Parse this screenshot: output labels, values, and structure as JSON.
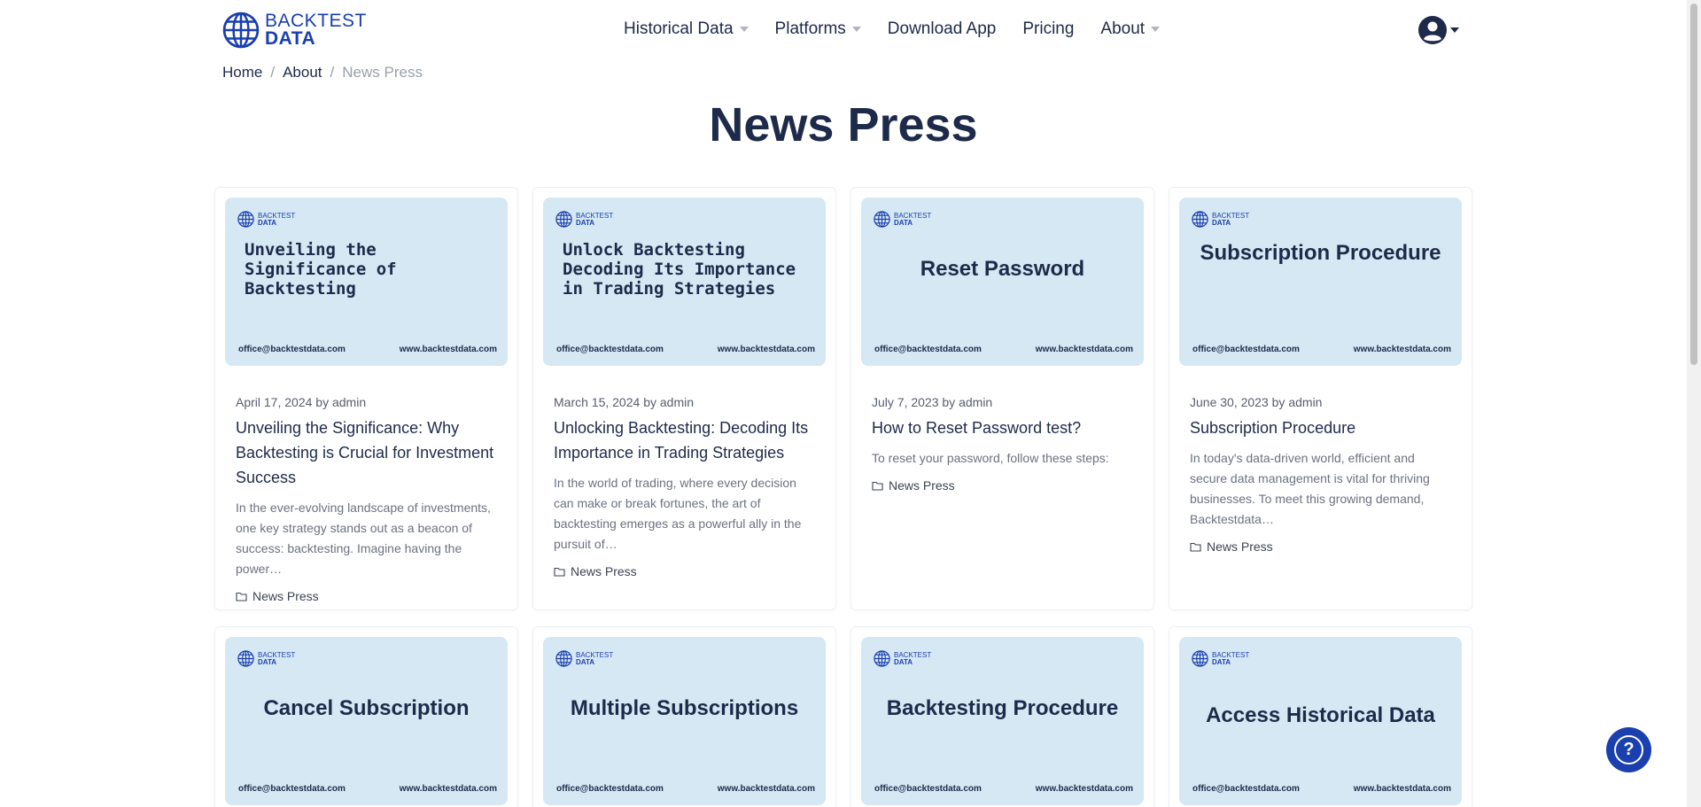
{
  "logo": {
    "line1": "BACKTEST",
    "line2": "DATA"
  },
  "nav": [
    {
      "label": "Historical Data",
      "has_dropdown": true
    },
    {
      "label": "Platforms",
      "has_dropdown": true
    },
    {
      "label": "Download App",
      "has_dropdown": false
    },
    {
      "label": "Pricing",
      "has_dropdown": false
    },
    {
      "label": "About",
      "has_dropdown": true
    }
  ],
  "breadcrumb": {
    "home": "Home",
    "about": "About",
    "current": "News Press",
    "separator": "/"
  },
  "page_title": "News Press",
  "thumb_footer": {
    "email": "office@backtestdata.com",
    "site": "www.backtestdata.com"
  },
  "posts": [
    {
      "thumb_title": "Unveiling the Significance of Backtesting",
      "date": "April 17, 2024",
      "by": "by",
      "author": "admin",
      "title": "Unveiling the Significance: Why Backtesting is Crucial for Investment Success",
      "excerpt": "In the ever-evolving landscape of investments, one key strategy stands out as a beacon of success: backtesting. Imagine having the power…",
      "category": "News Press"
    },
    {
      "thumb_title": "Unlock Backtesting Decoding Its Importance in Trading Strategies",
      "date": "March 15, 2024",
      "by": "by",
      "author": "admin",
      "title": "Unlocking Backtesting: Decoding Its Importance in Trading Strategies",
      "excerpt": "In the world of trading, where every decision can make or break fortunes, the art of backtesting emerges as a powerful ally in the pursuit of…",
      "category": "News Press"
    },
    {
      "thumb_title": "Reset Password",
      "date": "July 7, 2023",
      "by": "by",
      "author": "admin",
      "title": "How to Reset Password test?",
      "excerpt": "To reset your password, follow these steps:",
      "category": "News Press"
    },
    {
      "thumb_title": "Subscription Procedure",
      "date": "June 30, 2023",
      "by": "by",
      "author": "admin",
      "title": "Subscription Procedure",
      "excerpt": "In today's data-driven world, efficient and secure data management is vital for thriving businesses. To meet this growing demand, Backtestdata…",
      "category": "News Press"
    },
    {
      "thumb_title": "Cancel Subscription"
    },
    {
      "thumb_title": "Multiple Subscriptions"
    },
    {
      "thumb_title": "Backtesting Procedure"
    },
    {
      "thumb_title": "Access Historical Data"
    }
  ],
  "help_button": {
    "symbol": "?"
  },
  "colors": {
    "brand": "#1a3fae",
    "text": "#1e2a4a",
    "thumb_bg": "#d6e8f3"
  }
}
